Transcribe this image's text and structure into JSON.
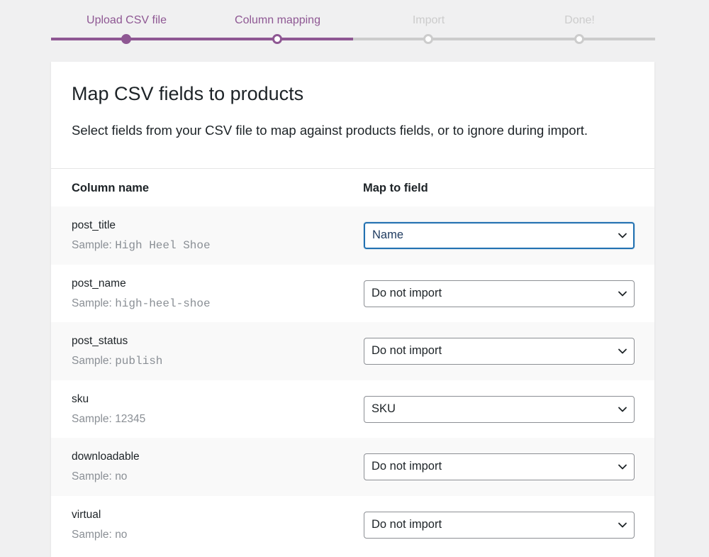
{
  "steps": [
    {
      "label": "Upload CSV file",
      "state": "done"
    },
    {
      "label": "Column mapping",
      "state": "active"
    },
    {
      "label": "Import",
      "state": "todo"
    },
    {
      "label": "Done!",
      "state": "todo"
    }
  ],
  "colors": {
    "accent": "#8e5793",
    "inactive": "#cccccc",
    "focus": "#2271b1"
  },
  "header": {
    "title": "Map CSV fields to products",
    "description": "Select fields from your CSV file to map against products fields, or to ignore during import."
  },
  "table": {
    "col_header_name": "Column name",
    "col_header_map": "Map to field",
    "sample_prefix": "Sample:",
    "rows": [
      {
        "name": "post_title",
        "sample": "High Heel Shoe",
        "mono": true,
        "field": "Name",
        "focused": true
      },
      {
        "name": "post_name",
        "sample": "high-heel-shoe",
        "mono": true,
        "field": "Do not import",
        "focused": false
      },
      {
        "name": "post_status",
        "sample": "publish",
        "mono": true,
        "field": "Do not import",
        "focused": false
      },
      {
        "name": "sku",
        "sample": "12345",
        "mono": false,
        "field": "SKU",
        "focused": false
      },
      {
        "name": "downloadable",
        "sample": "no",
        "mono": false,
        "field": "Do not import",
        "focused": false
      },
      {
        "name": "virtual",
        "sample": "no",
        "mono": false,
        "field": "Do not import",
        "focused": false
      }
    ]
  },
  "icons": {
    "select_arrow": "chevron-down-icon"
  }
}
